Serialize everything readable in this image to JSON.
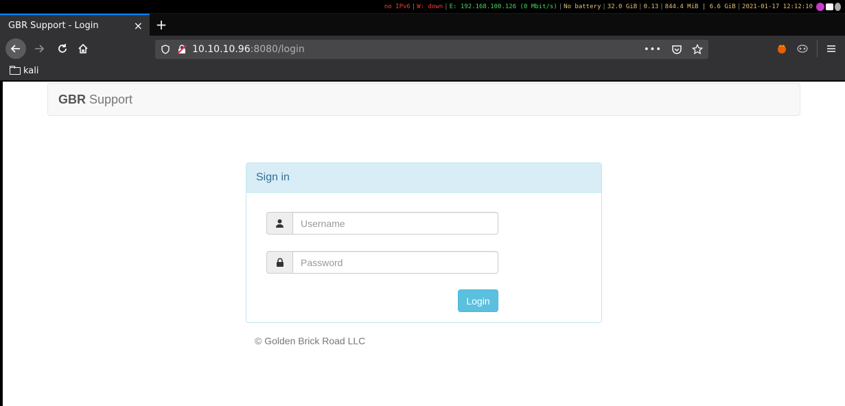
{
  "status_bar": {
    "ipv6": "no IPv6",
    "wifi": "W: down",
    "ethernet": "E: 192.168.100.126 (0 Mbit/s)",
    "battery": "No battery",
    "disk": "32.0 GiB",
    "load": "0.13",
    "memory": "844.4 MiB | 6.6 GiB",
    "datetime": "2021-01-17 12:12:10",
    "colors": {
      "red": "#ff3b30",
      "green": "#4cd964",
      "yellow": "#e5c07b"
    }
  },
  "browser": {
    "tab_title": "GBR Support - Login",
    "tab_close": "×",
    "new_tab": "+",
    "url_host": "10.10.10.96",
    "url_rest": ":8080/login",
    "bookmark_folder": "kali",
    "icons": [
      "back-icon",
      "forward-icon",
      "reload-icon",
      "home-icon",
      "shield-icon",
      "insecure-lock-icon",
      "more-icon",
      "pocket-icon",
      "star-icon",
      "firefox-extension-icon",
      "mask-extension-icon",
      "menu-icon"
    ]
  },
  "site": {
    "brand_bold": "GBR",
    "brand_rest": "Support",
    "panel_title": "Sign in",
    "username_placeholder": "Username",
    "password_placeholder": "Password",
    "login_label": "Login",
    "footer": "© Golden Brick Road LLC",
    "colors": {
      "panel_heading": "#d9edf7",
      "panel_border": "#bce8f1",
      "button": "#5bc0de"
    }
  }
}
